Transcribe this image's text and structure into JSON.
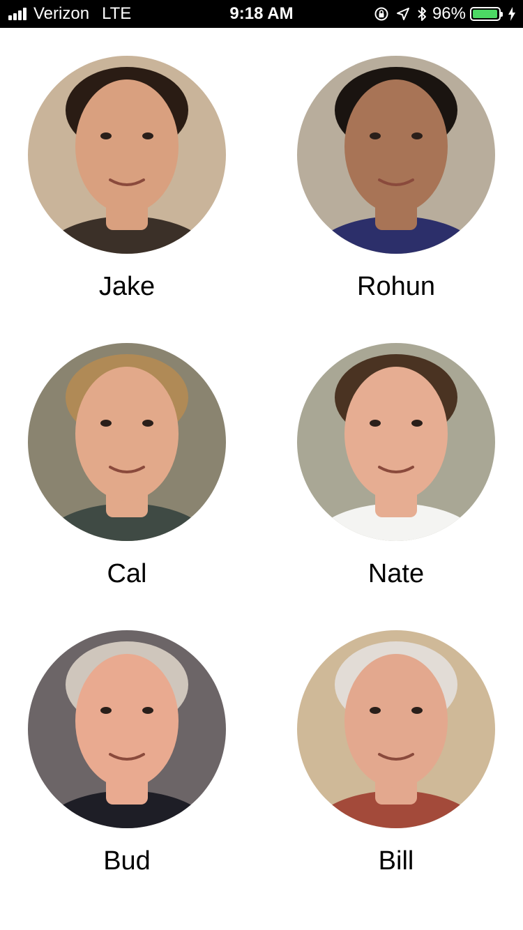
{
  "status_bar": {
    "carrier": "Verizon",
    "network": "LTE",
    "time": "9:18 AM",
    "battery_percent": "96%",
    "battery_level": 0.96,
    "battery_color": "#4cd964",
    "icons": [
      "signal-icon",
      "rotation-lock-icon",
      "location-arrow-icon",
      "bluetooth-icon",
      "battery-icon",
      "charging-bolt-icon"
    ]
  },
  "people": [
    {
      "name": "Jake",
      "skin": "#d9a07f",
      "hair": "#2a1c14",
      "shirt": "#3b3028",
      "bg": "#c9b49a"
    },
    {
      "name": "Rohun",
      "skin": "#a87456",
      "hair": "#1a1410",
      "shirt": "#2c2f6a",
      "bg": "#b8ad9c"
    },
    {
      "name": "Cal",
      "skin": "#e2a98a",
      "hair": "#b08a56",
      "shirt": "#3f4a44",
      "bg": "#8a8470"
    },
    {
      "name": "Nate",
      "skin": "#e6ad92",
      "hair": "#4a3322",
      "shirt": "#f4f4f2",
      "bg": "#a9a795"
    },
    {
      "name": "Bud",
      "skin": "#e9aa90",
      "hair": "#cfc6bc",
      "shirt": "#1e1e26",
      "bg": "#6c6567"
    },
    {
      "name": "Bill",
      "skin": "#e3a88e",
      "hair": "#e2dcd6",
      "shirt": "#a34a3a",
      "bg": "#cfb998"
    }
  ]
}
